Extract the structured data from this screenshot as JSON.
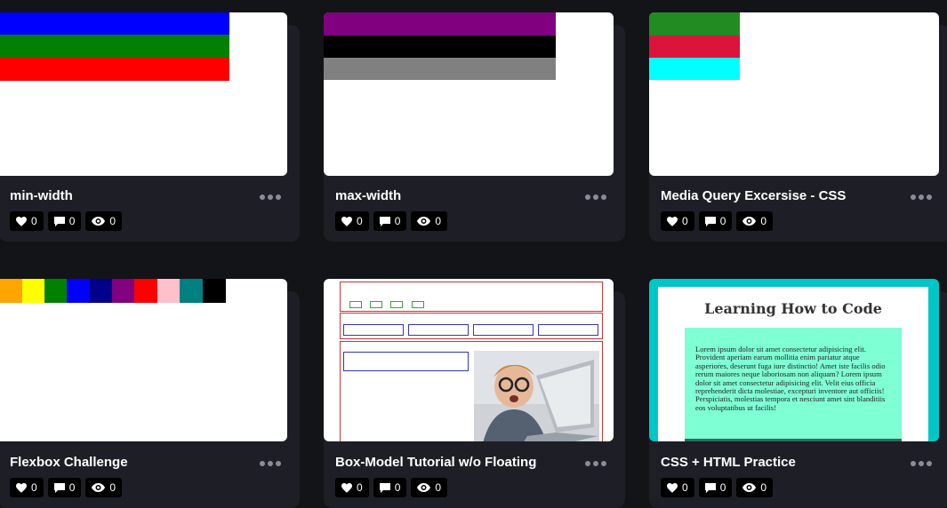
{
  "cards": [
    {
      "title": "min-width",
      "likes": "0",
      "comments": "0",
      "views": "0"
    },
    {
      "title": "max-width",
      "likes": "0",
      "comments": "0",
      "views": "0"
    },
    {
      "title": "Media Query Excersise - CSS",
      "likes": "0",
      "comments": "0",
      "views": "0"
    },
    {
      "title": "Flexbox Challenge",
      "likes": "0",
      "comments": "0",
      "views": "0"
    },
    {
      "title": "Box-Model Tutorial w/o Floating",
      "likes": "0",
      "comments": "0",
      "views": "0"
    },
    {
      "title": "CSS + HTML Practice",
      "likes": "0",
      "comments": "0",
      "views": "0"
    }
  ],
  "previews": {
    "lhtc_title": "Learning How to Code",
    "lhtc_body": "Lorem ipsum dolor sit amet consectetur adipisicing elit. Provident aperiam earum mollitia enim pariatur atque asperiores, deserunt fuga iure distinctio! Amet iste facilis odio rerum maiores neque laboriosam non aliquam? Lorem ipsum dolor sit amet consectetur adipisicing elit. Velit eius officia reprehenderit dicta molestiae, excepturi inventore aut officiis! Perspiciatis, molestias tempora et nesciunt amet sint blanditiis eos voluptatibus ut facilis!"
  },
  "colors": {
    "page_bg": "#131417",
    "card_bg": "#1e1f26",
    "stat_bg": "#000000",
    "teal": "#00c7c7",
    "mint": "#7fffd4"
  }
}
